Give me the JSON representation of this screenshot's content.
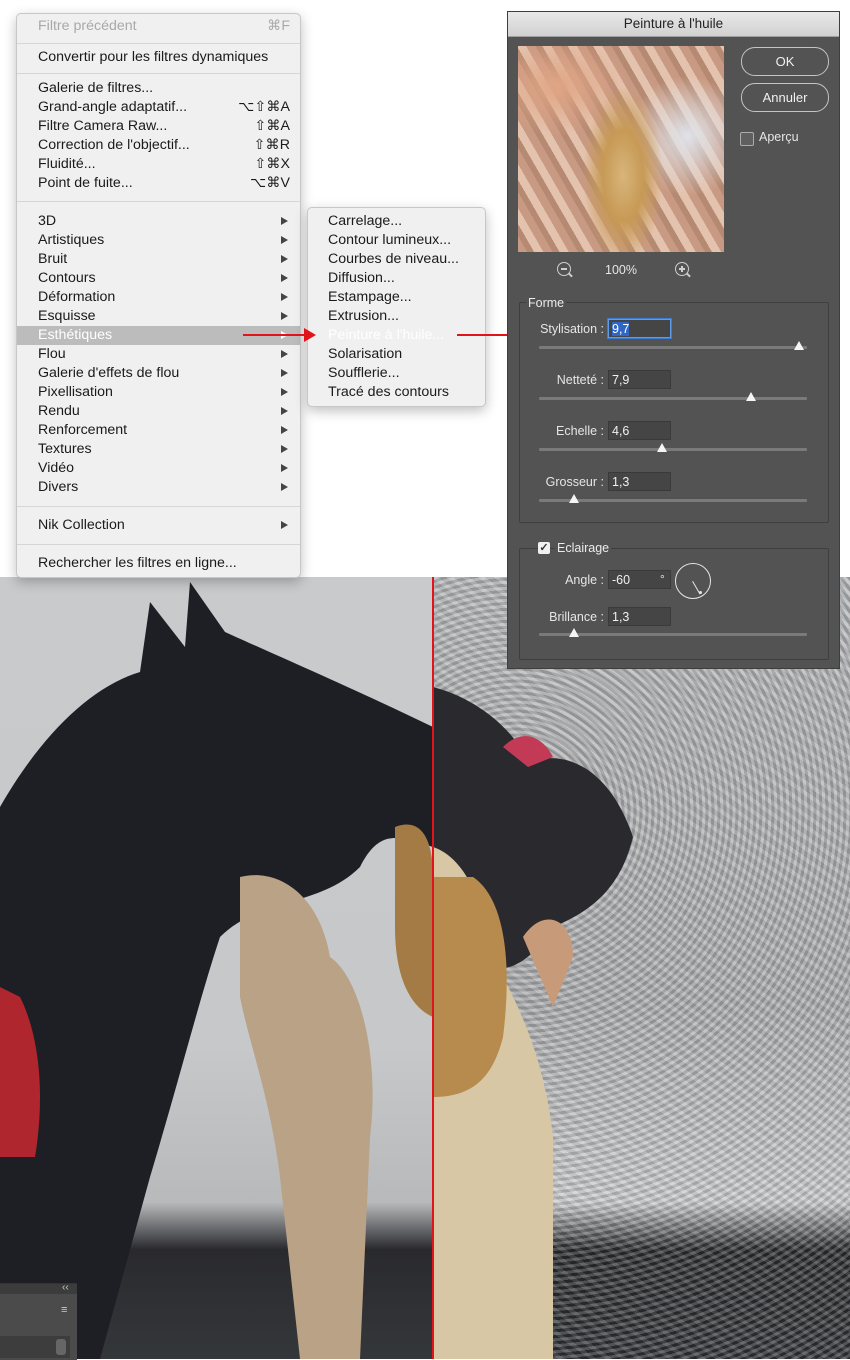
{
  "menu": {
    "items": [
      {
        "label": "Filtre précédent",
        "shortcut": "⌘F",
        "state": "disabled"
      },
      {
        "label": "Convertir pour les filtres dynamiques"
      },
      {
        "label": "Galerie de filtres..."
      },
      {
        "label": "Grand-angle adaptatif...",
        "shortcut": "⌥⇧⌘A"
      },
      {
        "label": "Filtre Camera Raw...",
        "shortcut": "⇧⌘A"
      },
      {
        "label": "Correction de l'objectif...",
        "shortcut": "⇧⌘R"
      },
      {
        "label": "Fluidité...",
        "shortcut": "⇧⌘X"
      },
      {
        "label": "Point de fuite...",
        "shortcut": "⌥⌘V"
      },
      {
        "label": "3D",
        "submenu": true
      },
      {
        "label": "Artistiques",
        "submenu": true
      },
      {
        "label": "Bruit",
        "submenu": true
      },
      {
        "label": "Contours",
        "submenu": true
      },
      {
        "label": "Déformation",
        "submenu": true
      },
      {
        "label": "Esquisse",
        "submenu": true
      },
      {
        "label": "Esthétiques",
        "submenu": true,
        "state": "highlighted"
      },
      {
        "label": "Flou",
        "submenu": true
      },
      {
        "label": "Galerie d'effets de flou",
        "submenu": true
      },
      {
        "label": "Pixellisation",
        "submenu": true
      },
      {
        "label": "Rendu",
        "submenu": true
      },
      {
        "label": "Renforcement",
        "submenu": true
      },
      {
        "label": "Textures",
        "submenu": true
      },
      {
        "label": "Vidéo",
        "submenu": true
      },
      {
        "label": "Divers",
        "submenu": true
      },
      {
        "label": "Nik Collection",
        "submenu": true
      },
      {
        "label": "Rechercher les filtres en ligne..."
      }
    ]
  },
  "submenu": {
    "items": [
      {
        "label": "Carrelage..."
      },
      {
        "label": "Contour lumineux..."
      },
      {
        "label": "Courbes de niveau..."
      },
      {
        "label": "Diffusion..."
      },
      {
        "label": "Estampage..."
      },
      {
        "label": "Extrusion..."
      },
      {
        "label": "Peinture à l'huile...",
        "state": "highlighted"
      },
      {
        "label": "Solarisation"
      },
      {
        "label": "Soufflerie..."
      },
      {
        "label": "Tracé des contours"
      }
    ]
  },
  "dialog": {
    "title": "Peinture à l'huile",
    "ok_label": "OK",
    "cancel_label": "Annuler",
    "preview_label": "Aperçu",
    "preview_checked": false,
    "zoom_level": "100%",
    "forme": {
      "title": "Forme",
      "fields": [
        {
          "label": "Stylisation :",
          "value": "9,7",
          "slider_fraction": 0.97,
          "focused": true
        },
        {
          "label": "Netteté :",
          "value": "7,9",
          "slider_fraction": 0.79
        },
        {
          "label": "Echelle :",
          "value": "4,6",
          "slider_fraction": 0.46
        },
        {
          "label": "Grosseur :",
          "value": "1,3",
          "slider_fraction": 0.13
        }
      ]
    },
    "eclairage": {
      "title": "Eclairage",
      "checked": true,
      "angle_label": "Angle :",
      "angle_value": "-60",
      "angle_unit": "°",
      "brillance_label": "Brillance :",
      "brillance_value": "1,3",
      "brillance_slider_fraction": 0.13
    }
  },
  "colors": {
    "annotation_red": "#e0141a",
    "dialog_bg": "#535353",
    "menu_bg": "#f0f0f0",
    "menu_highlight": "#bcbcbc"
  }
}
